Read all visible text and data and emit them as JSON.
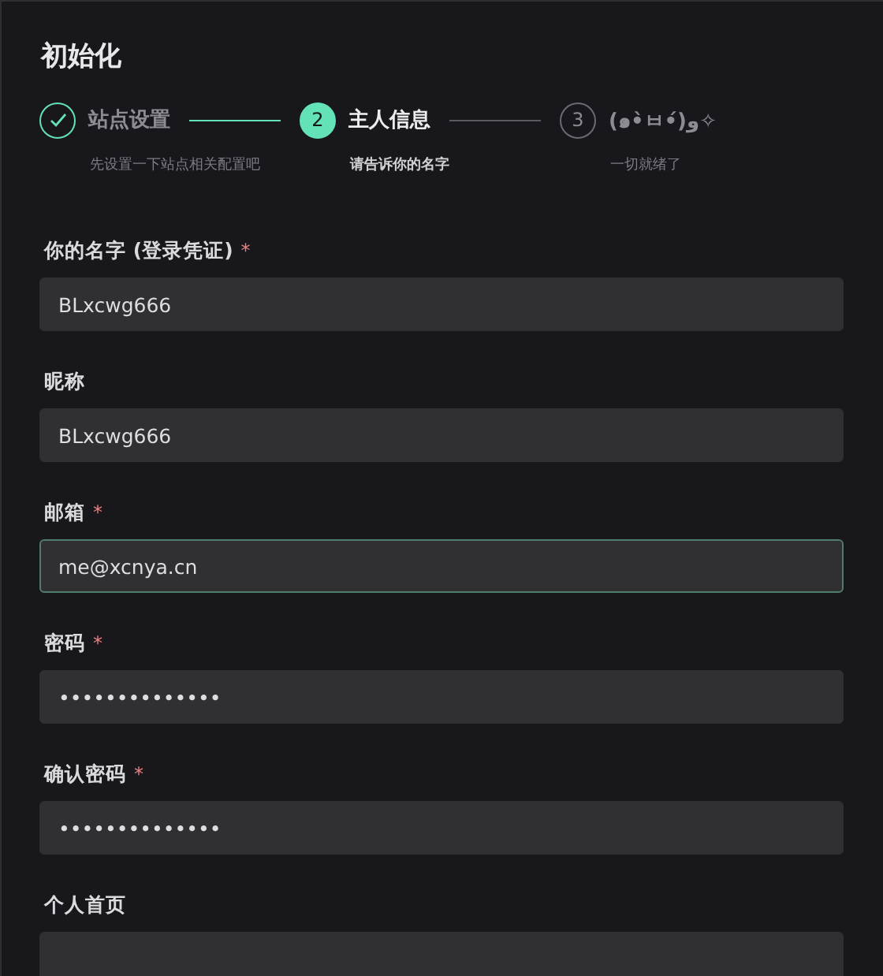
{
  "title": "初始化",
  "steps": [
    {
      "title": "站点设置",
      "description": "先设置一下站点相关配置吧",
      "completed": true,
      "selected": false
    },
    {
      "number": "2",
      "title": "主人信息",
      "description": "请告诉你的名字",
      "completed": false,
      "selected": true
    },
    {
      "number": "3",
      "title": "(๑•̀ㅂ•́)و✧",
      "description": "一切就绪了",
      "completed": false,
      "selected": false
    }
  ],
  "fields": [
    {
      "label": "你的名字 (登录凭证)",
      "required_mark": "*",
      "value": "BLxcwg666",
      "focused": false
    },
    {
      "label": "昵称",
      "value": "BLxcwg666",
      "focused": false
    },
    {
      "label": "邮箱",
      "required_mark": "*",
      "value": "me@xcnya.cn",
      "focused": true
    },
    {
      "label": "密码",
      "required_mark": "*",
      "value": "••••••••••••••",
      "focused": false
    },
    {
      "label": "确认密码",
      "required_mark": "*",
      "value": "••••••••••••••",
      "focused": false
    },
    {
      "label": "个人首页",
      "focused": false
    }
  ]
}
